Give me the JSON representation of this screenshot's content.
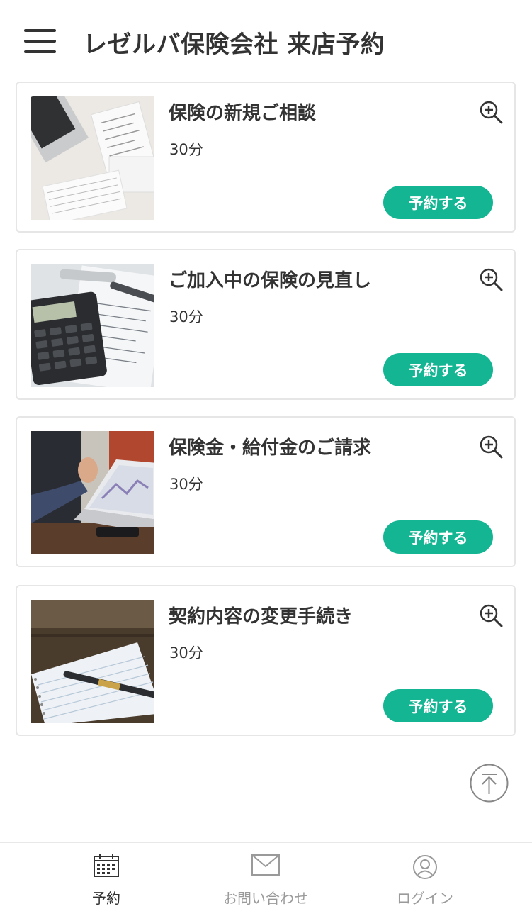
{
  "header": {
    "title": "レゼルバ保険会社 来店予約"
  },
  "menus": [
    {
      "title": "保険の新規ご相談",
      "duration": "30分",
      "button": "予約する"
    },
    {
      "title": "ご加入中の保険の見直し",
      "duration": "30分",
      "button": "予約する"
    },
    {
      "title": "保険金・給付金のご請求",
      "duration": "30分",
      "button": "予約する"
    },
    {
      "title": "契約内容の変更手続き",
      "duration": "30分",
      "button": "予約する"
    }
  ],
  "bottom_nav": [
    {
      "label": "予約",
      "icon": "calendar-icon",
      "active": true
    },
    {
      "label": "お問い合わせ",
      "icon": "mail-icon",
      "active": false
    },
    {
      "label": "ログイン",
      "icon": "user-icon",
      "active": false
    }
  ],
  "colors": {
    "accent": "#14b592",
    "text": "#333333",
    "inactive": "#9a9a9a",
    "border": "#e6e6e6"
  }
}
